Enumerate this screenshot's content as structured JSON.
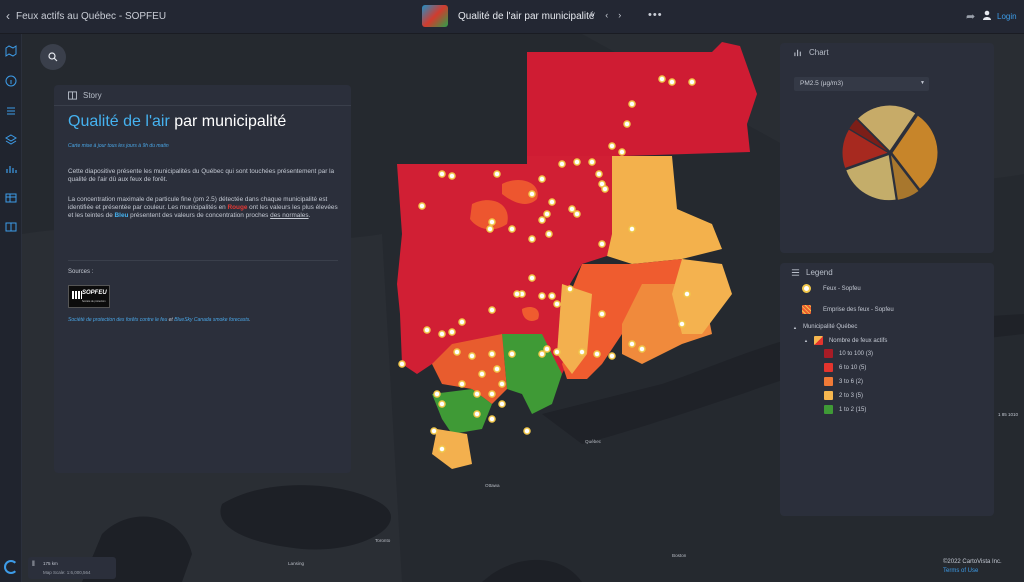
{
  "header": {
    "back_label": "Feux actifs au Québec - SOPFEU",
    "story_title": "Qualité de l'air par municipalité",
    "more": "•••",
    "login": "Login"
  },
  "story_panel": {
    "label": "Story",
    "title_highlight": "Qualité de l'air",
    "title_rest": " par municipalité",
    "updated": "Carte mise à jour tous les jours à 9h du matin",
    "para1": "Cette diapositive présente les municipalités du Québec qui sont touchées présentement par la qualité de l'air dû aux feux de forêt.",
    "para2_a": "La concentration maximale de particule fine  (pm 2.5) détectée dans chaque municipalité est identifiée et présentée par couleur. Les municipalités en ",
    "para2_rouge": "Rouge",
    "para2_b": " ont les valeurs les plus élevées et les teintes de ",
    "para2_bleu": "Bleu",
    "para2_c": " présentent des valeurs de concentration proches ",
    "para2_link": "des normales",
    "para2_d": ".",
    "sources_label": "Sources :",
    "logo_word": "SOPFEU",
    "logo_sub": "Société de protection",
    "credit_a": "Société de protection des forêts contre le feu",
    "credit_b": " et ",
    "credit_c": "BlueSky Canada smoke forecasts",
    "credit_d": "."
  },
  "chart_panel": {
    "label": "Chart",
    "select_value": "PM2.5 (µg/m3)"
  },
  "chart_data": {
    "type": "pie",
    "title": "",
    "slices": [
      {
        "value": 30,
        "color": "#c7852a"
      },
      {
        "value": 8,
        "color": "#a8772d"
      },
      {
        "value": 22,
        "color": "#c4ad6a"
      },
      {
        "value": 14,
        "color": "#a7291f"
      },
      {
        "value": 4,
        "color": "#7c1e18"
      },
      {
        "value": 22,
        "color": "#c7ab68"
      }
    ]
  },
  "legend_panel": {
    "label": "Legend",
    "fires_label": "Feux - Sopfeu",
    "footprint_label": "Emprise des feux - Sopfeu",
    "group_label": "Municipalité Québec",
    "subgroup_label": "Nombre de feux actifs",
    "classes": [
      {
        "label": "10 to 100 (3)",
        "color": "#a81c26"
      },
      {
        "label": "6 to 10 (5)",
        "color": "#e4342d"
      },
      {
        "label": "3 to 6 (2)",
        "color": "#f07a37"
      },
      {
        "label": "2 to 3 (5)",
        "color": "#f6b74f"
      },
      {
        "label": "1 to 2 (15)",
        "color": "#3f9a36"
      }
    ]
  },
  "map": {
    "places": [
      "Québec",
      "Ottawa",
      "Toronto",
      "Boston",
      "Lansing"
    ],
    "coord_text": "1 85 1010",
    "scale_km": "175 km",
    "map_scale": "Map Scale: 1:6,000,564",
    "copyright": "©2022 CartoVista Inc.",
    "terms": "Terms of Use"
  }
}
